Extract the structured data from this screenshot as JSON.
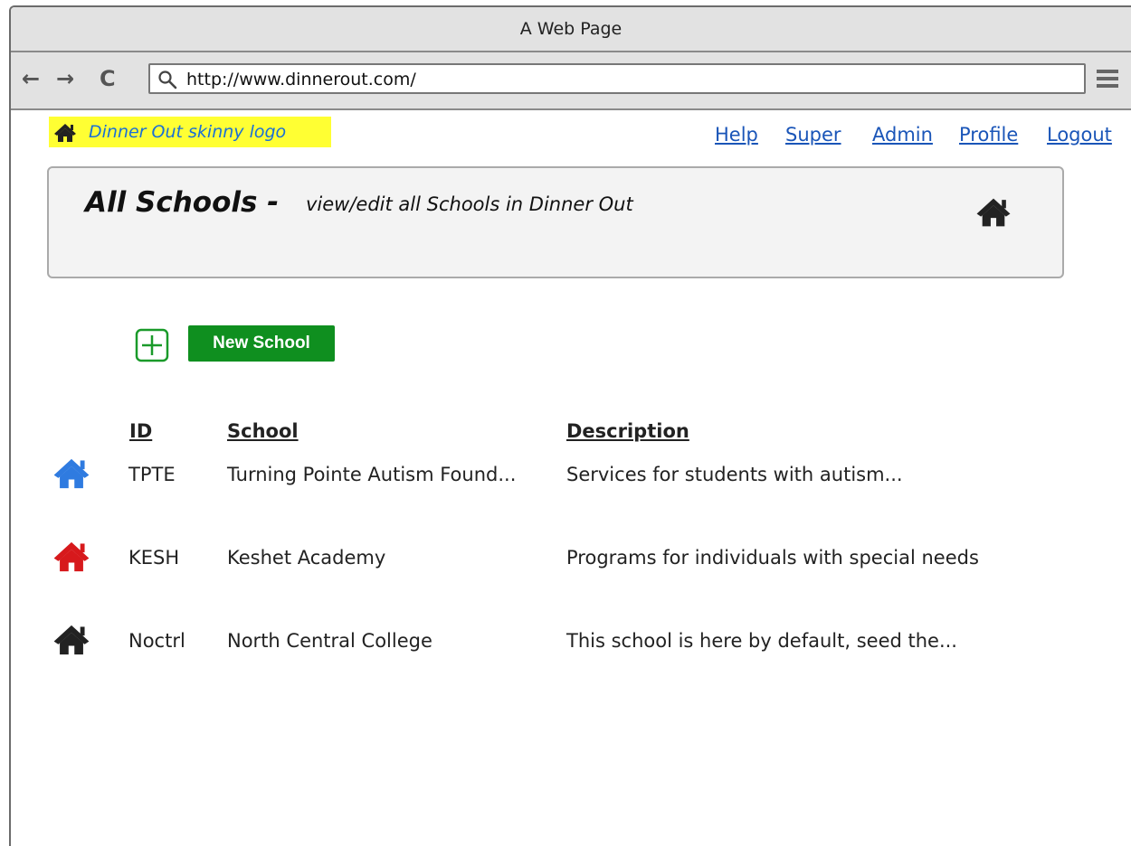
{
  "browser": {
    "title": "A Web Page",
    "url": "http://www.dinnerout.com/",
    "nav_icons": [
      "back-arrow-icon",
      "forward-arrow-icon",
      "reload-icon"
    ],
    "back_glyph": "←",
    "forward_glyph": "→",
    "reload_glyph": "C"
  },
  "logo": {
    "text": "Dinner Out skinny logo",
    "background": "#ffff33"
  },
  "top_links": [
    "Help",
    "Super",
    "Admin",
    "Profile",
    "Logout"
  ],
  "header": {
    "title": "All Schools -",
    "subtitle": "view/edit all Schools in Dinner Out"
  },
  "new_school_button": {
    "label": "New School",
    "color": "#0f8f1f"
  },
  "table": {
    "headers": {
      "id": "ID",
      "school": "School",
      "description": "Description"
    },
    "rows": [
      {
        "id": "TPTE",
        "school": "Turning Pointe Autism Found...",
        "description": "Services for students with autism...",
        "icon_color": "#2f7be0"
      },
      {
        "id": "KESH",
        "school": "Keshet Academy",
        "description": "Programs for individuals with special needs",
        "icon_color": "#d7191c"
      },
      {
        "id": "Noctrl",
        "school": "North Central College",
        "description": "This school is here by default, seed the...",
        "icon_color": "#222222"
      }
    ]
  },
  "colors": {
    "link": "#1a55b8",
    "logo_text": "#1a6fd6"
  }
}
